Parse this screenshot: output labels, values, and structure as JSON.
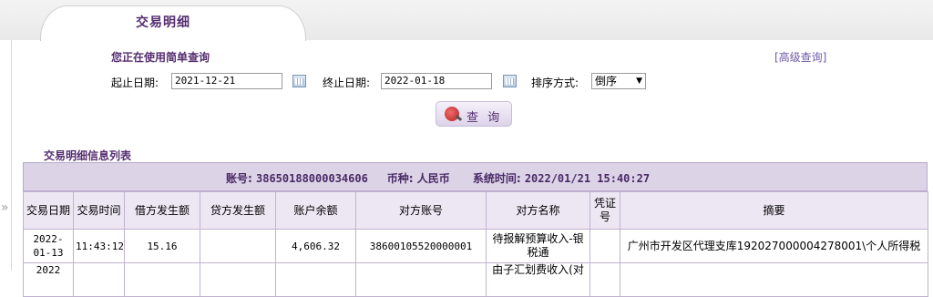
{
  "tab": {
    "title": "交易明细"
  },
  "simple_query": {
    "title": "您正在使用简单查询",
    "advanced_link": "[高级查询]",
    "start_label": "起止日期:",
    "start_value": "2021-12-21",
    "end_label": "终止日期:",
    "end_value": "2022-01-18",
    "sort_label": "排序方式:",
    "sort_value": "倒序",
    "query_button": "查 询"
  },
  "list": {
    "title": "交易明细信息列表",
    "summary": {
      "account_label": "账号:",
      "account_value": "38650188000034606",
      "currency_label": "币种:",
      "currency_value": "人民币",
      "systime_label": "系统时间:",
      "systime_value": "2022/01/21 15:40:27"
    },
    "columns": [
      "交易日期",
      "交易时间",
      "借方发生额",
      "贷方发生额",
      "账户余额",
      "对方账号",
      "对方名称",
      "凭证号",
      "摘要"
    ],
    "rows": [
      {
        "date": "2022-01-13",
        "time": "11:43:12",
        "debit": "15.16",
        "credit": "",
        "balance": "4,606.32",
        "counter_account": "38600105520000001",
        "counter_name": "待报解预算收入-银税通",
        "voucher": "",
        "memo": "广州市开发区代理支库192027000004278001\\个人所得税"
      }
    ],
    "next_row_partial": {
      "date": "2022",
      "counter_name": "由子汇划费收入(对"
    }
  },
  "icons": {
    "calendar": "calendar-icon",
    "query": "globe-search-icon",
    "collapse": "double-chevron-right-icon"
  },
  "colors": {
    "accent": "#552e6f",
    "header_bg": "#dcd3e7",
    "link": "#6d5aa8"
  }
}
